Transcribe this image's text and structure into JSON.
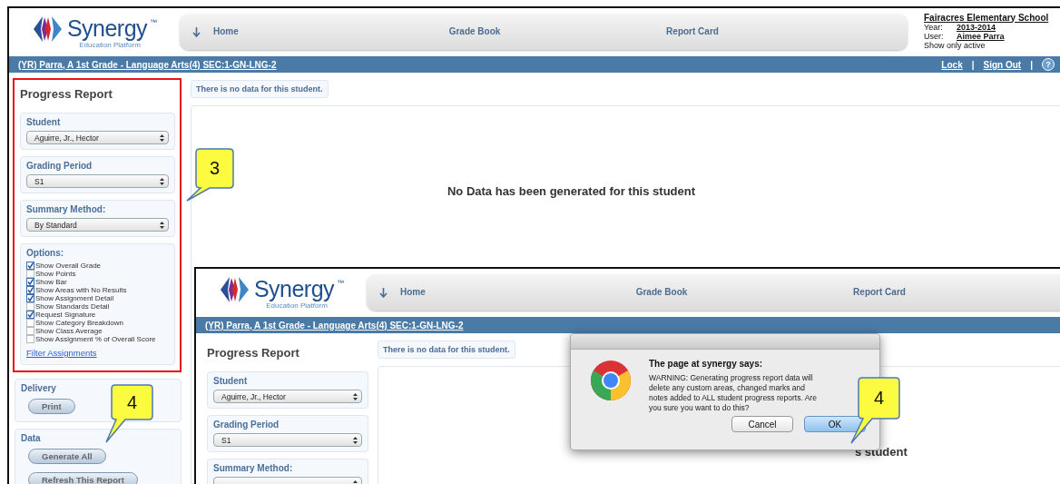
{
  "header": {
    "logo": {
      "name": "Synergy",
      "trademark": "™",
      "tagline": "Education Platform"
    },
    "nav": [
      {
        "label": "Home",
        "kind": "home"
      },
      {
        "label": "Grade Book",
        "kind": "plain"
      },
      {
        "label": "Report Card",
        "kind": "plain"
      }
    ],
    "school": {
      "name": "Fairacres Elementary School",
      "year_label": "Year:",
      "year": "2013-2014",
      "user_label": "User:",
      "user": "Aimee Parra",
      "filter": "Show only active"
    }
  },
  "section_bar": {
    "title": "(YR) Parra, A 1st Grade - Language Arts(4) SEC:1-GN-LNG-2",
    "links": [
      "Lock",
      "Sign Out"
    ],
    "separator": "|",
    "help": "?"
  },
  "sidebar": {
    "highlighted": {
      "title": "Progress Report",
      "groups": [
        {
          "kind": "select",
          "label": "Student",
          "value": "Aguirre, Jr., Hector"
        },
        {
          "kind": "select",
          "label": "Grading Period",
          "value": "S1"
        },
        {
          "kind": "select",
          "label": "Summary Method:",
          "value": "By Standard"
        },
        {
          "kind": "options",
          "label": "Options:",
          "options": [
            {
              "label": "Show Overall Grade",
              "checked": true
            },
            {
              "label": "Show Points",
              "checked": false
            },
            {
              "label": "Show Bar",
              "checked": true
            },
            {
              "label": "Show Areas with No Results",
              "checked": true
            },
            {
              "label": "Show Assignment Detail",
              "checked": true
            },
            {
              "label": "Show Standards Detail",
              "checked": false
            },
            {
              "label": "Request Signature",
              "checked": true
            },
            {
              "label": "Show Category Breakdown",
              "checked": false
            },
            {
              "label": "Show Class Average",
              "checked": false
            },
            {
              "label": "Show Assignment % of Overall Score",
              "checked": false
            }
          ],
          "link": "Filter Assignments"
        }
      ]
    },
    "groups": [
      {
        "kind": "buttons",
        "label": "Delivery",
        "buttons": [
          "Print"
        ]
      },
      {
        "kind": "buttons",
        "label": "Data",
        "buttons": [
          "Generate All",
          "Refresh This Report"
        ]
      }
    ]
  },
  "main": {
    "notice": "There is no data for this student.",
    "message": "No Data has been generated for this student"
  },
  "inset": {
    "header": {
      "logo": {
        "name": "Synergy",
        "trademark": "™",
        "tagline": "Education Platform"
      },
      "nav": [
        {
          "label": "Home",
          "kind": "home"
        },
        {
          "label": "Grade Book",
          "kind": "plain"
        },
        {
          "label": "Report Card",
          "kind": "plain"
        }
      ]
    },
    "section_bar": {
      "title": "(YR) Parra, A 1st Grade - Language Arts(4) SEC:1-GN-LNG-2"
    },
    "sidebar": {
      "title": "Progress Report",
      "groups": [
        {
          "kind": "select",
          "label": "Student",
          "value": "Aguirre, Jr., Hector"
        },
        {
          "kind": "select",
          "label": "Grading Period",
          "value": "S1"
        },
        {
          "kind": "select",
          "label": "Summary Method:"
        }
      ]
    },
    "notice": "There is no data for this student.",
    "message_fragment": "s student"
  },
  "dialog": {
    "title": "The page at synergy says:",
    "message": "WARNING: Generating progress report data will delete any custom areas, changed marks and notes added to ALL student progress reports. Are you sure you want to do this?",
    "buttons": [
      {
        "label": "Cancel",
        "default": false
      },
      {
        "label": "OK",
        "default": true
      }
    ]
  },
  "callouts": [
    {
      "text": "3"
    },
    {
      "text": "4"
    },
    {
      "text": "4"
    }
  ]
}
